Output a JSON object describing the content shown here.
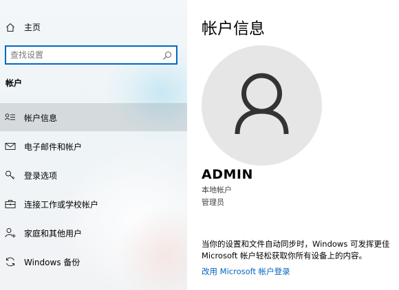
{
  "sidebar": {
    "home_label": "主页",
    "search_placeholder": "查找设置",
    "section_title": "帐户",
    "items": [
      {
        "label": "帐户信息",
        "icon": "person-list-icon",
        "active": true
      },
      {
        "label": "电子邮件和帐户",
        "icon": "mail-icon",
        "active": false
      },
      {
        "label": "登录选项",
        "icon": "key-icon",
        "active": false
      },
      {
        "label": "连接工作或学校帐户",
        "icon": "briefcase-icon",
        "active": false
      },
      {
        "label": "家庭和其他用户",
        "icon": "person-add-icon",
        "active": false
      },
      {
        "label": "Windows 备份",
        "icon": "sync-icon",
        "active": false
      }
    ]
  },
  "main": {
    "title": "帐户信息",
    "user_name": "ADMIN",
    "account_type": "本地帐户",
    "role": "管理员",
    "sync_line1": "当你的设置和文件自动同步时，Windows 可发挥更佳",
    "sync_line2": "Microsoft 帐户轻松获取你所有设备上的内容。",
    "link_text": "改用 Microsoft 帐户登录"
  },
  "colors": {
    "accent": "#0067c0",
    "avatar_bg": "#e6e6e6",
    "avatar_fg": "#333333"
  }
}
